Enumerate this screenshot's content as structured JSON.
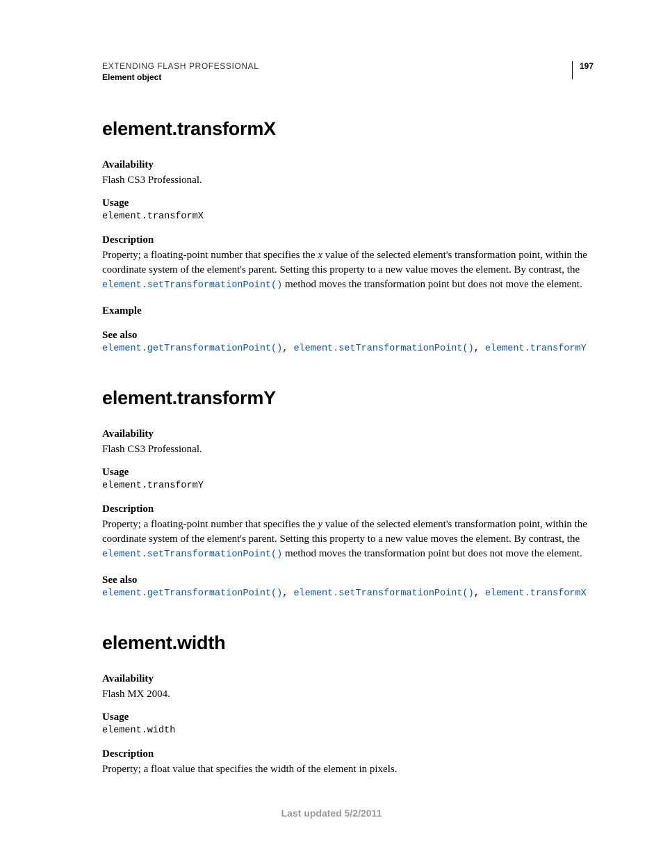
{
  "header": {
    "breadcrumb": "EXTENDING FLASH PROFESSIONAL",
    "section": "Element object",
    "pagenum": "197"
  },
  "sections": [
    {
      "title": "element.transformX",
      "availability": {
        "label": "Availability",
        "text": "Flash CS3 Professional."
      },
      "usage": {
        "label": "Usage",
        "code": "element.transformX"
      },
      "description": {
        "label": "Description",
        "pre": "Property; a floating-point number that specifies the ",
        "var": "x",
        "mid": " value of the selected element's transformation point, within the coordinate system of the element's parent. Setting this property to a new value moves the element. By contrast, the ",
        "link": "element.setTransformationPoint()",
        "post": " method moves the transformation point but does not move the element."
      },
      "example": {
        "label": "Example"
      },
      "seealso": {
        "label": "See also",
        "links": [
          "element.getTransformationPoint()",
          "element.setTransformationPoint()",
          "element.transformY"
        ]
      }
    },
    {
      "title": "element.transformY",
      "availability": {
        "label": "Availability",
        "text": "Flash CS3 Professional."
      },
      "usage": {
        "label": "Usage",
        "code": "element.transformY"
      },
      "description": {
        "label": "Description",
        "pre": "Property; a floating-point number that specifies the ",
        "var": "y",
        "mid": " value of the selected element's transformation point, within the coordinate system of the element's parent. Setting this property to a new value moves the element. By contrast, the ",
        "link": "element.setTransformationPoint()",
        "post": " method moves the transformation point but does not move the element."
      },
      "seealso": {
        "label": "See also",
        "links": [
          "element.getTransformationPoint()",
          "element.setTransformationPoint()",
          "element.transformX"
        ]
      }
    },
    {
      "title": "element.width",
      "availability": {
        "label": "Availability",
        "text": "Flash MX 2004."
      },
      "usage": {
        "label": "Usage",
        "code": "element.width"
      },
      "description": {
        "label": "Description",
        "plain": "Property; a float value that specifies the width of the element in pixels."
      }
    }
  ],
  "footer": "Last updated 5/2/2011",
  "sep": ", "
}
